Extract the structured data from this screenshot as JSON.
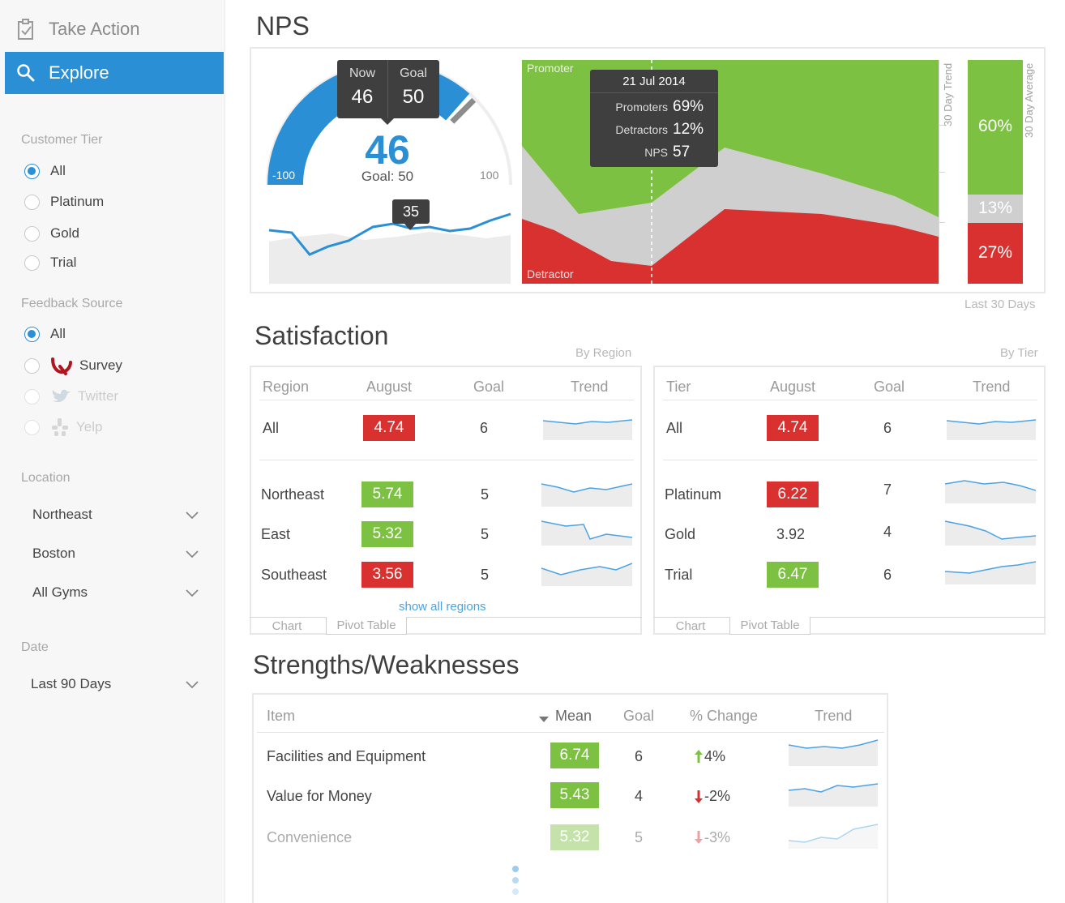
{
  "sidebar": {
    "take_action": "Take Action",
    "explore": "Explore",
    "customer_tier": {
      "label": "Customer Tier",
      "options": [
        "All",
        "Platinum",
        "Gold",
        "Trial"
      ],
      "selected": "All"
    },
    "feedback_source": {
      "label": "Feedback Source",
      "options": [
        "All",
        "Survey",
        "Twitter",
        "Yelp"
      ],
      "selected": "All"
    },
    "location": {
      "label": "Location",
      "selects": [
        "Northeast",
        "Boston",
        "All Gyms"
      ]
    },
    "date": {
      "label": "Date",
      "select": "Last 90 Days"
    }
  },
  "nps": {
    "title": "NPS",
    "gauge": {
      "value": "46",
      "goal_text": "Goal: 50",
      "min": "-100",
      "max": "100",
      "tooltip": {
        "now_label": "Now",
        "now_value": "46",
        "goal_label": "Goal",
        "goal_value": "50"
      },
      "spark_tooltip": "35",
      "value_num": 46,
      "goal_num": 50
    },
    "trend": {
      "promoter_label": "Promoter",
      "detractor_label": "Detractor",
      "axis_label": "30 Day Trend",
      "tooltip": {
        "date": "21 Jul 2014",
        "rows": [
          {
            "label": "Promoters",
            "value": "69%"
          },
          {
            "label": "Detractors",
            "value": "12%"
          },
          {
            "label": "NPS",
            "value": "57"
          }
        ]
      }
    },
    "average": {
      "axis_label": "30 Day Average",
      "promoters": "60%",
      "passives": "13%",
      "detractors": "27%",
      "promoters_num": 60,
      "passives_num": 13,
      "detractors_num": 27
    },
    "caption": "Last 30 Days"
  },
  "satisfaction": {
    "title": "Satisfaction",
    "by_region": {
      "caption": "By Region",
      "headers": [
        "Region",
        "August",
        "Goal",
        "Trend"
      ],
      "rows": [
        {
          "name": "All",
          "august": "4.74",
          "status": "red",
          "goal": "6"
        },
        {
          "name": "Northeast",
          "august": "5.74",
          "status": "green",
          "goal": "5"
        },
        {
          "name": "East",
          "august": "5.32",
          "status": "green",
          "goal": "5"
        },
        {
          "name": "Southeast",
          "august": "3.56",
          "status": "red",
          "goal": "5"
        }
      ],
      "link": "show all regions",
      "tabs": [
        "Chart",
        "Pivot Table"
      ]
    },
    "by_tier": {
      "caption": "By Tier",
      "headers": [
        "Tier",
        "August",
        "Goal",
        "Trend"
      ],
      "rows": [
        {
          "name": "All",
          "august": "4.74",
          "status": "red",
          "goal": "6"
        },
        {
          "name": "Platinum",
          "august": "6.22",
          "status": "red",
          "goal": "7"
        },
        {
          "name": "Gold",
          "august": "3.92",
          "status": "none",
          "goal": "4"
        },
        {
          "name": "Trial",
          "august": "6.47",
          "status": "green",
          "goal": "6"
        }
      ],
      "tabs": [
        "Chart",
        "Pivot Table"
      ]
    }
  },
  "strengths": {
    "title": "Strengths/Weaknesses",
    "headers": [
      "Item",
      "Mean",
      "Goal",
      "% Change",
      "Trend"
    ],
    "rows": [
      {
        "item": "Facilities and Equipment",
        "mean": "6.74",
        "goal": "6",
        "change": "4%",
        "direction": "up"
      },
      {
        "item": "Value for Money",
        "mean": "5.43",
        "goal": "4",
        "change": "-2%",
        "direction": "down"
      },
      {
        "item": "Convenience",
        "mean": "5.32",
        "goal": "5",
        "change": "-3%",
        "direction": "down"
      }
    ]
  },
  "colors": {
    "accent": "#2b8fd6",
    "promoter": "#7dc142",
    "passive": "#cfcfcf",
    "detractor": "#d9312f"
  }
}
